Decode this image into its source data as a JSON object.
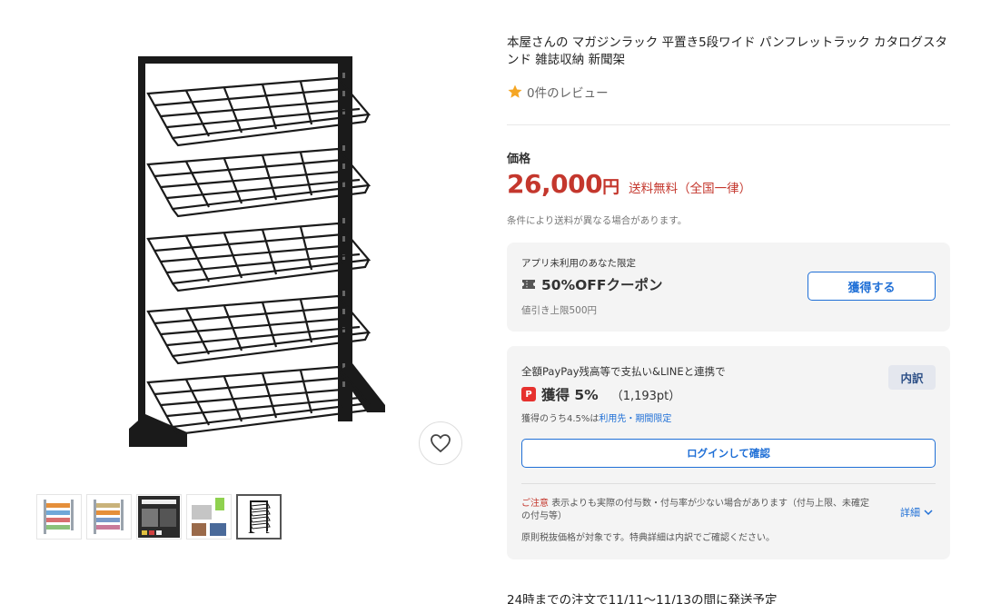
{
  "product": {
    "title": "本屋さんの マガジンラック 平置き5段ワイド パンフレットラック カタログスタンド 雑誌収納 新聞架",
    "review_text": "0件のレビュー"
  },
  "price": {
    "label": "価格",
    "amount": "26,000",
    "unit": "円",
    "shipping": "送料無料（全国一律）",
    "note": "条件により送料が異なる場合があります。"
  },
  "coupon": {
    "eligibility": "アプリ未利用のあなた限定",
    "title": "50%OFFクーポン",
    "limit": "値引き上限500円",
    "button": "獲得する"
  },
  "paypay": {
    "condition": "全額PayPay残高等で支払い&LINEと連携で",
    "breakdown_button": "内訳",
    "icon_letter": "P",
    "earn": "獲得 5%",
    "points": "（1,193pt）",
    "note_prefix": "獲得のうち4.5%は",
    "note_link": "利用先・期間限定",
    "login_button": "ログインして確認",
    "caution_label": "ご注意",
    "caution_text": "表示よりも実際の付与数・付与率が少ない場合があります（付与上限、未確定の付与等）",
    "detail_link": "詳細",
    "tax_note": "原則税抜価格が対象です。特典詳細は内訳でご確認ください。"
  },
  "delivery": {
    "text": "24時までの注文で11/11〜11/13の間に発送予定"
  },
  "icons": {
    "favorite": "heart-icon",
    "star": "star-icon",
    "coupon": "ticket-icon",
    "paypay": "paypay-icon",
    "chevron": "chevron-down-icon"
  },
  "colors": {
    "price": "#c4372d",
    "link": "#1f6fd6",
    "star": "#f5a623",
    "panel": "#f4f4f4"
  }
}
